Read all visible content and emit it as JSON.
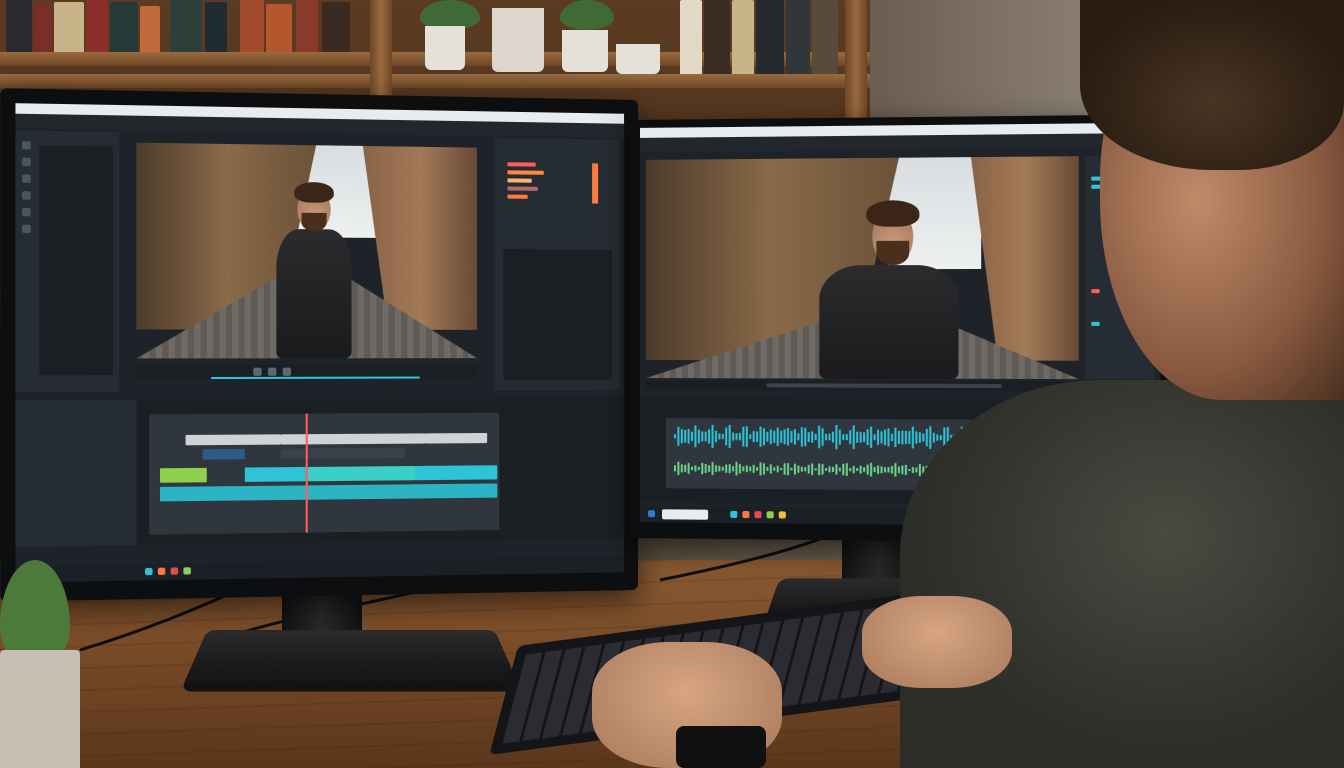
{
  "scene": {
    "description_colors": {
      "desk": "#7a4c28",
      "wall": "#5a4a3b",
      "accent_cyan": "#2ec4d6",
      "accent_green": "#8fd14f",
      "accent_orange": "#ff7a3d"
    }
  },
  "left_monitor": {
    "app": {
      "icons": [
        "play-icon",
        "pause-icon",
        "stop-icon",
        "scissors-icon",
        "settings-icon"
      ]
    },
    "scopes_colors": [
      "#ff5e5e",
      "#ff8a3d",
      "#ffb36b",
      "#b56a6a",
      "#ff7a3d"
    ],
    "timeline_clip_colors": [
      "#cfd3d6",
      "#2e5a8a",
      "#8fd14f",
      "#2ec4d6",
      "#3ad0c8"
    ]
  },
  "right_monitor": {
    "audio_wave_colors": [
      "#2ec4d6",
      "#6ad48a"
    ]
  }
}
